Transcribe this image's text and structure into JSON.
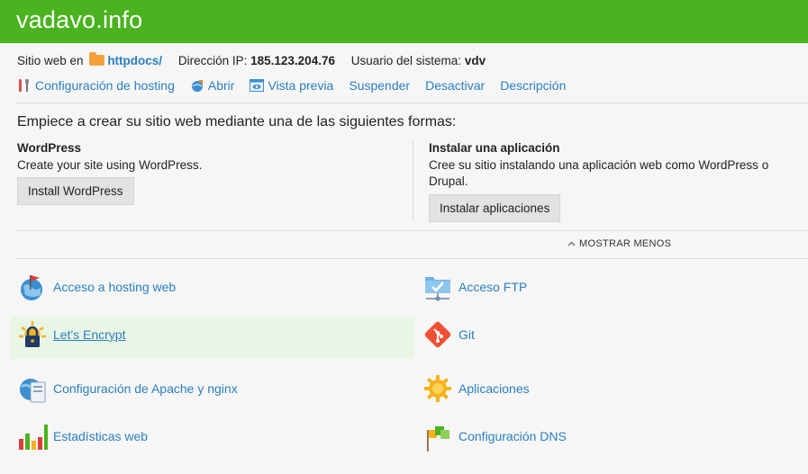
{
  "header": {
    "title": "vadavo.info"
  },
  "info": {
    "site_prefix": "Sitio web en",
    "site_folder": "httpdocs/",
    "ip_label": "Dirección IP:",
    "ip_value": "185.123.204.76",
    "user_label": "Usuario del sistema:",
    "user_value": "vdv"
  },
  "actions": [
    {
      "label": "Configuración de hosting",
      "icon": "hosting-settings-icon"
    },
    {
      "label": "Abrir",
      "icon": "open-globe-icon"
    },
    {
      "label": "Vista previa",
      "icon": "preview-icon"
    },
    {
      "label": "Suspender"
    },
    {
      "label": "Desactivar"
    },
    {
      "label": "Descripción"
    }
  ],
  "intro": "Empiece a crear su sitio web mediante una de las siguientes formas:",
  "wordpress": {
    "heading": "WordPress",
    "text": "Create your site using WordPress.",
    "button": "Install WordPress"
  },
  "apps": {
    "heading": "Instalar una aplicación",
    "text_line1": "Cree su sitio instalando una aplicación web como WordPress o",
    "text_line2": "Drupal.",
    "button": "Instalar aplicaciones"
  },
  "toggle": {
    "label": "MOSTRAR MENOS"
  },
  "tools": [
    {
      "label": "Acceso a hosting web",
      "icon": "globe-flag-icon"
    },
    {
      "label": "Acceso FTP",
      "icon": "ftp-folder-icon"
    },
    {
      "label": "Let's Encrypt",
      "icon": "lock-sun-icon"
    },
    {
      "label": "Git",
      "icon": "git-icon"
    },
    {
      "label": "Configuración de Apache y nginx",
      "icon": "server-globe-icon"
    },
    {
      "label": "Aplicaciones",
      "icon": "gear-icon"
    },
    {
      "label": "Estadísticas web",
      "icon": "bar-chart-icon"
    },
    {
      "label": "Configuración DNS",
      "icon": "dns-flags-icon"
    }
  ],
  "colors": {
    "header": "#4ab31f",
    "link": "#2a7fc0",
    "highlight": "#eaf6e5"
  }
}
